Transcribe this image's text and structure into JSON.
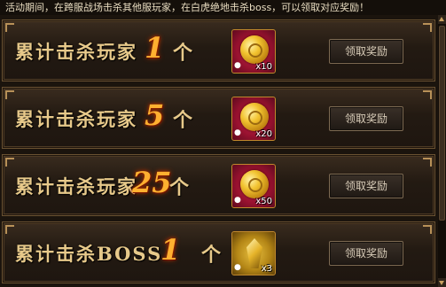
{
  "notice": "活动期间，在跨服战场击杀其他服玩家，在白虎绝地击杀boss，可以领取对应奖励！",
  "rows": [
    {
      "label": "累计击杀玩家",
      "count": "1",
      "unit": "个",
      "item_icon": "gold-coin-icon",
      "quantity": "x10",
      "button": "领取奖励"
    },
    {
      "label": "累计击杀玩家",
      "count": "5",
      "unit": "个",
      "item_icon": "gold-coin-icon",
      "quantity": "x20",
      "button": "领取奖励"
    },
    {
      "label": "累计击杀玩家",
      "count": "25",
      "unit": "个",
      "item_icon": "gold-coin-icon",
      "quantity": "x50",
      "button": "领取奖励"
    },
    {
      "label": "累计击杀BOSS",
      "count": "1",
      "unit": "个",
      "item_icon": "gold-emblem-icon",
      "quantity": "x3",
      "button": "领取奖励"
    }
  ],
  "colors": {
    "accent": "#e7c98a",
    "count": "#ffb030",
    "background": "#1b140d"
  }
}
